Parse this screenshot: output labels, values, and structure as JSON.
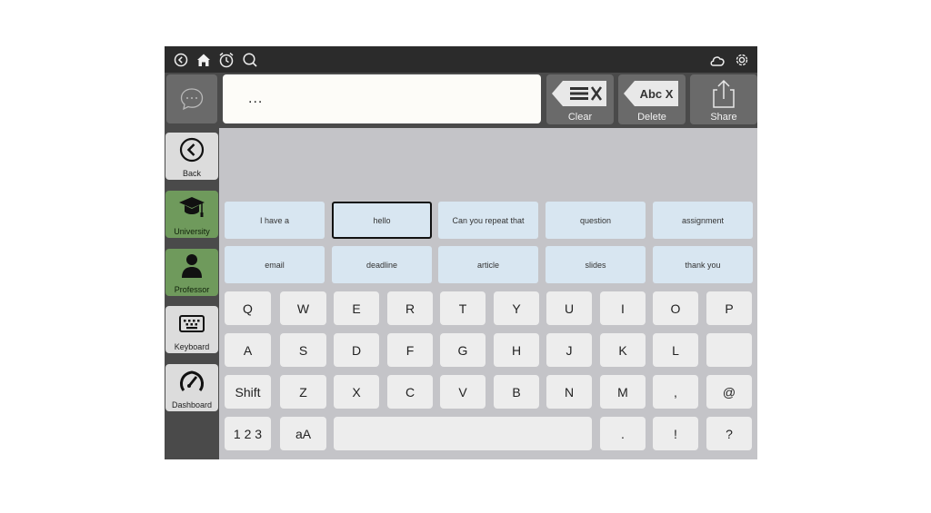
{
  "topbar": {
    "left_icons": [
      "back-circle-icon",
      "home-icon",
      "alarm-clock-icon",
      "search-icon"
    ],
    "right_icons": [
      "cloud-icon",
      "gear-icon"
    ]
  },
  "message": {
    "text": "...",
    "chat_icon": "speech-bubble-icon"
  },
  "actions": [
    {
      "label": "Clear",
      "icon": "clear-lines-x-icon"
    },
    {
      "label": "Delete",
      "icon_text": "Abc X",
      "icon": "delete-abc-x-icon"
    },
    {
      "label": "Share",
      "icon": "share-icon"
    }
  ],
  "sidebar": {
    "items": [
      {
        "label": "Back",
        "icon": "back-chevron-icon",
        "active": false
      },
      {
        "label": "University",
        "icon": "graduation-cap-icon",
        "active": true
      },
      {
        "label": "Professor",
        "icon": "person-icon",
        "active": true
      },
      {
        "label": "Keyboard",
        "icon": "keyboard-icon",
        "active": false
      },
      {
        "label": "Dashboard",
        "icon": "speedometer-icon",
        "active": false
      }
    ]
  },
  "phrases": {
    "row1": [
      "I have a",
      "hello",
      "Can you repeat that",
      "question",
      "assignment"
    ],
    "row2": [
      "email",
      "deadline",
      "article",
      "slides",
      "thank you"
    ],
    "selected": "hello"
  },
  "keyboard": {
    "row1": [
      "Q",
      "W",
      "E",
      "R",
      "T",
      "Y",
      "U",
      "I",
      "O",
      "P"
    ],
    "row2": [
      "A",
      "S",
      "D",
      "F",
      "G",
      "H",
      "J",
      "K",
      "L",
      ""
    ],
    "row3": [
      "Shift",
      "Z",
      "X",
      "C",
      "V",
      "B",
      "N",
      "M",
      ",",
      "@"
    ],
    "row4": {
      "numbers": "1 2 3",
      "case": "aA",
      "space": "",
      "period": ".",
      "exclaim": "!",
      "question": "?"
    }
  }
}
